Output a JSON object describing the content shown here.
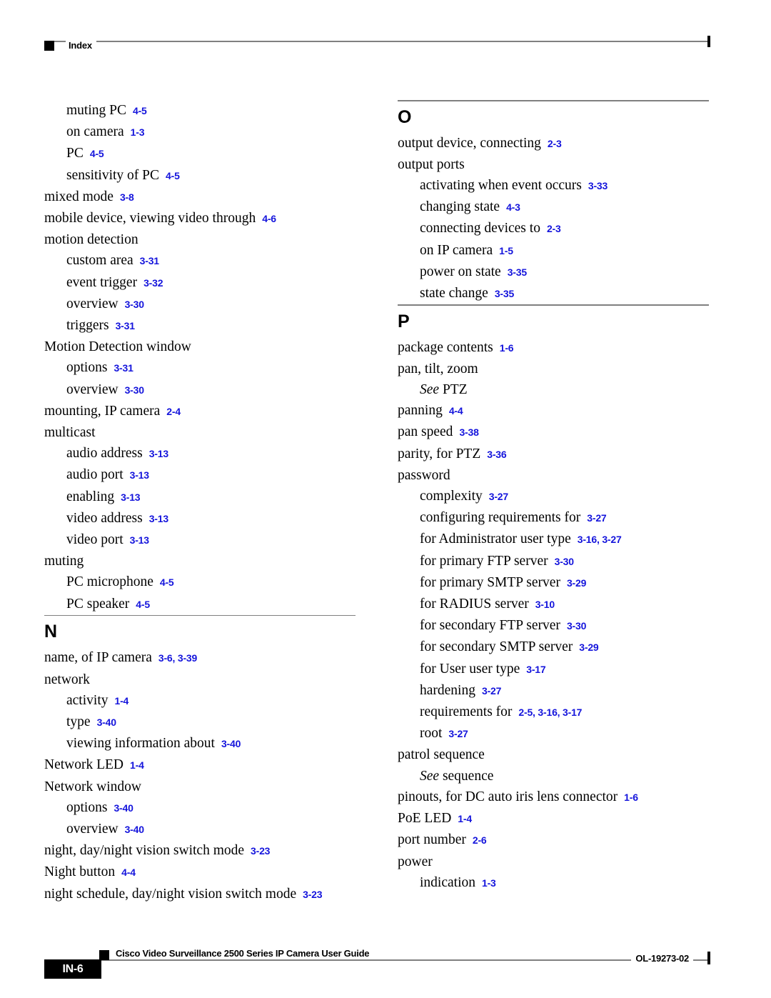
{
  "header": {
    "title": "Index",
    "marker_icon": "black-square-marker"
  },
  "footer": {
    "page_number": "IN-6",
    "guide_title": "Cisco Video Surveillance 2500 Series IP Camera User Guide",
    "document_id": "OL-19273-02",
    "marker_icon": "black-square-marker"
  },
  "colors": {
    "page_reference": "#1414dc",
    "rule": "#808080",
    "text": "#000000",
    "marker": "#000000"
  },
  "columns": [
    {
      "name": "left-column",
      "blocks": [
        {
          "type": "entries",
          "entries": [
            {
              "level": 2,
              "term": "muting PC",
              "pages": "4-5"
            },
            {
              "level": 2,
              "term": "on camera",
              "pages": "1-3"
            },
            {
              "level": 2,
              "term": "PC",
              "pages": "4-5"
            },
            {
              "level": 2,
              "term": "sensitivity of PC",
              "pages": "4-5"
            },
            {
              "level": 1,
              "term": "mixed mode",
              "pages": "3-8"
            },
            {
              "level": 1,
              "term": "mobile device, viewing video through",
              "pages": "4-6"
            },
            {
              "level": 1,
              "term": "motion detection",
              "pages": ""
            },
            {
              "level": 2,
              "term": "custom area",
              "pages": "3-31"
            },
            {
              "level": 2,
              "term": "event trigger",
              "pages": "3-32"
            },
            {
              "level": 2,
              "term": "overview",
              "pages": "3-30"
            },
            {
              "level": 2,
              "term": "triggers",
              "pages": "3-31"
            },
            {
              "level": 1,
              "term": "Motion Detection window",
              "pages": ""
            },
            {
              "level": 2,
              "term": "options",
              "pages": "3-31"
            },
            {
              "level": 2,
              "term": "overview",
              "pages": "3-30"
            },
            {
              "level": 1,
              "term": "mounting, IP camera",
              "pages": "2-4"
            },
            {
              "level": 1,
              "term": "multicast",
              "pages": ""
            },
            {
              "level": 2,
              "term": "audio address",
              "pages": "3-13"
            },
            {
              "level": 2,
              "term": "audio port",
              "pages": "3-13"
            },
            {
              "level": 2,
              "term": "enabling",
              "pages": "3-13"
            },
            {
              "level": 2,
              "term": "video address",
              "pages": "3-13"
            },
            {
              "level": 2,
              "term": "video port",
              "pages": "3-13"
            },
            {
              "level": 1,
              "term": "muting",
              "pages": ""
            },
            {
              "level": 2,
              "term": "PC microphone",
              "pages": "4-5"
            },
            {
              "level": 2,
              "term": "PC speaker",
              "pages": "4-5"
            }
          ]
        },
        {
          "type": "section",
          "letter": "N",
          "entries": [
            {
              "level": 1,
              "term": "name, of IP camera",
              "pages": "3-6, 3-39"
            },
            {
              "level": 1,
              "term": "network",
              "pages": ""
            },
            {
              "level": 2,
              "term": "activity",
              "pages": "1-4"
            },
            {
              "level": 2,
              "term": "type",
              "pages": "3-40"
            },
            {
              "level": 2,
              "term": "viewing information about",
              "pages": "3-40"
            },
            {
              "level": 1,
              "term": "Network LED",
              "pages": "1-4"
            },
            {
              "level": 1,
              "term": "Network window",
              "pages": ""
            },
            {
              "level": 2,
              "term": "options",
              "pages": "3-40"
            },
            {
              "level": 2,
              "term": "overview",
              "pages": "3-40"
            },
            {
              "level": 1,
              "term": "night, day/night vision switch mode",
              "pages": "3-23"
            },
            {
              "level": 1,
              "term": "Night button",
              "pages": "4-4"
            },
            {
              "level": 1,
              "term": "night schedule, day/night vision switch mode",
              "pages": "3-23"
            }
          ]
        }
      ]
    },
    {
      "name": "right-column",
      "blocks": [
        {
          "type": "section",
          "letter": "O",
          "entries": [
            {
              "level": 1,
              "term": "output device, connecting",
              "pages": "2-3"
            },
            {
              "level": 1,
              "term": "output ports",
              "pages": ""
            },
            {
              "level": 2,
              "term": "activating when event occurs",
              "pages": "3-33"
            },
            {
              "level": 2,
              "term": "changing state",
              "pages": "4-3"
            },
            {
              "level": 2,
              "term": "connecting devices to",
              "pages": "2-3"
            },
            {
              "level": 2,
              "term": "on IP camera",
              "pages": "1-5"
            },
            {
              "level": 2,
              "term": "power on state",
              "pages": "3-35"
            },
            {
              "level": 2,
              "term": "state change",
              "pages": "3-35"
            }
          ]
        },
        {
          "type": "section",
          "letter": "P",
          "entries": [
            {
              "level": 1,
              "term": "package contents",
              "pages": "1-6"
            },
            {
              "level": 1,
              "term": "pan, tilt, zoom",
              "pages": ""
            },
            {
              "level": 2,
              "see": "See",
              "term": "PTZ",
              "pages": ""
            },
            {
              "level": 1,
              "term": "panning",
              "pages": "4-4"
            },
            {
              "level": 1,
              "term": "pan speed",
              "pages": "3-38"
            },
            {
              "level": 1,
              "term": "parity, for PTZ",
              "pages": "3-36"
            },
            {
              "level": 1,
              "term": "password",
              "pages": ""
            },
            {
              "level": 2,
              "term": "complexity",
              "pages": "3-27"
            },
            {
              "level": 2,
              "term": "configuring requirements for",
              "pages": "3-27"
            },
            {
              "level": 2,
              "term": "for Administrator user type",
              "pages": "3-16, 3-27"
            },
            {
              "level": 2,
              "term": "for primary FTP server",
              "pages": "3-30"
            },
            {
              "level": 2,
              "term": "for primary SMTP server",
              "pages": "3-29"
            },
            {
              "level": 2,
              "term": "for RADIUS server",
              "pages": "3-10"
            },
            {
              "level": 2,
              "term": "for secondary FTP server",
              "pages": "3-30"
            },
            {
              "level": 2,
              "term": "for secondary SMTP server",
              "pages": "3-29"
            },
            {
              "level": 2,
              "term": "for User user type",
              "pages": "3-17"
            },
            {
              "level": 2,
              "term": "hardening",
              "pages": "3-27"
            },
            {
              "level": 2,
              "term": "requirements for",
              "pages": "2-5, 3-16, 3-17"
            },
            {
              "level": 2,
              "term": "root",
              "pages": "3-27"
            },
            {
              "level": 1,
              "term": "patrol sequence",
              "pages": ""
            },
            {
              "level": 2,
              "see": "See",
              "term": "sequence",
              "pages": ""
            },
            {
              "level": 1,
              "term": "pinouts, for DC auto iris lens connector",
              "pages": "1-6"
            },
            {
              "level": 1,
              "term": "PoE LED",
              "pages": "1-4"
            },
            {
              "level": 1,
              "term": "port number",
              "pages": "2-6"
            },
            {
              "level": 1,
              "term": "power",
              "pages": ""
            },
            {
              "level": 2,
              "term": "indication",
              "pages": "1-3"
            }
          ]
        }
      ]
    }
  ]
}
